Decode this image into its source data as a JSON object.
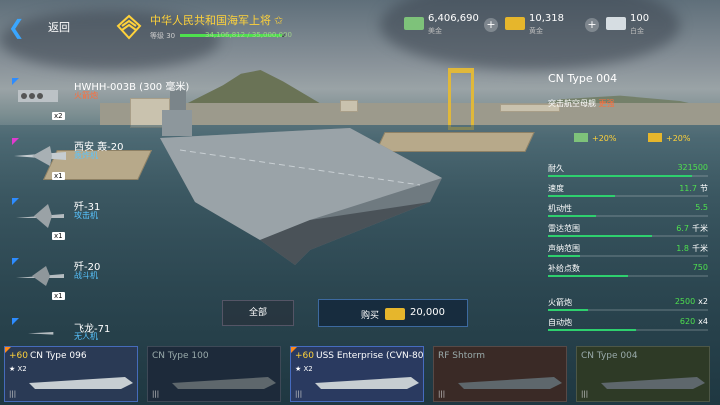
{
  "topbar": {
    "back_label": "返回",
    "rank_title": "中华人民共和国海军上将",
    "level_label": "等级 30",
    "xp_text": "34,106,812 / 35,000,000",
    "xp_progress": 0.974
  },
  "currencies": [
    {
      "icon": "cash-icon",
      "value": "6,406,690",
      "name": "美金",
      "color": "#7ec27a"
    },
    {
      "icon": "gold-bar-icon",
      "value": "10,318",
      "name": "黄金",
      "color": "#e6b62c"
    },
    {
      "icon": "platinum-bar-icon",
      "value": "100",
      "name": "白金",
      "color": "#d6dde2"
    }
  ],
  "units": [
    {
      "name": "HWHH-003B (300 毫米)",
      "type": "火箭炮",
      "count": "x2",
      "type_color": "orange",
      "corner": "blue"
    },
    {
      "name": "西安 轰-20",
      "type": "轰炸机",
      "count": "x1",
      "type_color": "blue",
      "corner": "pink"
    },
    {
      "name": "歼-31",
      "type": "攻击机",
      "count": "x1",
      "type_color": "blue",
      "corner": "blue"
    },
    {
      "name": "歼-20",
      "type": "战斗机",
      "count": "x1",
      "type_color": "blue",
      "corner": "blue"
    },
    {
      "name": "飞龙-71",
      "type": "无人机",
      "count": "",
      "type_color": "blue",
      "corner": "blue"
    }
  ],
  "ship": {
    "title": "CN Type 004",
    "subtitle": "突击航空母舰",
    "upgrade": "更强",
    "bonus_cash": "+20%",
    "bonus_gold": "+20%"
  },
  "stats": [
    {
      "label": "耐久",
      "value": "321500",
      "unit": "",
      "fill": 0.9
    },
    {
      "label": "速度",
      "value": "11.7",
      "unit": "节",
      "fill": 0.42
    },
    {
      "label": "机动性",
      "value": "5.5",
      "unit": "",
      "fill": 0.3
    },
    {
      "label": "雷达范围",
      "value": "6.7",
      "unit": "千米",
      "fill": 0.65
    },
    {
      "label": "声纳范围",
      "value": "1.8",
      "unit": "千米",
      "fill": 0.2
    },
    {
      "label": "补给点数",
      "value": "750",
      "unit": "",
      "fill": 0.5
    },
    {
      "label": "火箭炮",
      "value": "2500",
      "unit": "x2",
      "fill": 0.25
    },
    {
      "label": "自动炮",
      "value": "620",
      "unit": "x4",
      "fill": 0.55
    }
  ],
  "buttons": {
    "all_label": "全部",
    "buy_label": "购买",
    "buy_price": "20,000"
  },
  "cards": [
    {
      "plus": "+60",
      "name": "CN Type 096",
      "x": "★ X2",
      "highlight": true,
      "bg": "#2a3a55"
    },
    {
      "plus": "",
      "name": "CN Type 100",
      "x": "",
      "highlight": false,
      "bg": "#1d2a3a"
    },
    {
      "plus": "+60",
      "name": "USS Enterprise (CVN-80)",
      "x": "★ X2",
      "highlight": true,
      "bg": "#2a3a60"
    },
    {
      "plus": "",
      "name": "RF Shtorm",
      "x": "",
      "highlight": false,
      "bg": "#3a2a26"
    },
    {
      "plus": "",
      "name": "CN Type 004",
      "x": "",
      "highlight": false,
      "bg": "#2e3a26"
    }
  ],
  "colors": {
    "accent": "#3aa6ff",
    "gold": "#ffd23a",
    "green": "#4ee04e",
    "stat_bar": "#2ed06e"
  }
}
